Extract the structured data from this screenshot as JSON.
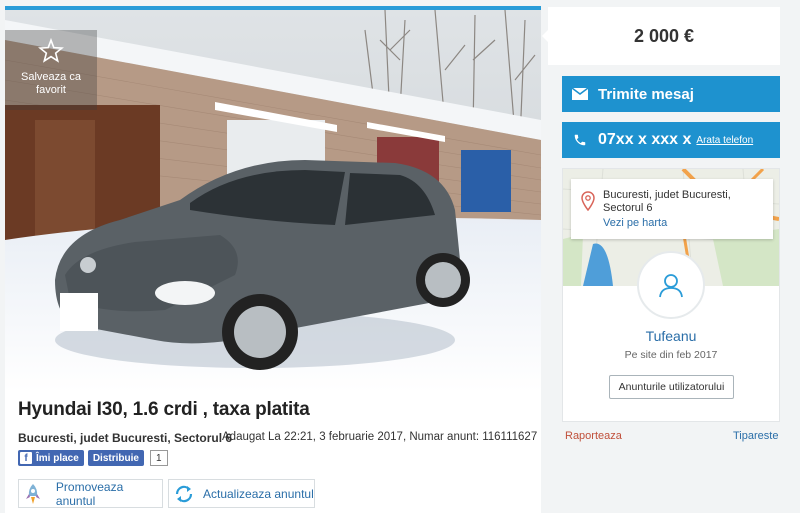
{
  "listing": {
    "favorite_label": "Salveaza ca favorit",
    "title": "Hyundai I30, 1.6 crdi , taxa platita",
    "location": "Bucuresti, judet Bucuresti, Sectorul 6",
    "meta": "Adaugat La 22:21, 3 februarie 2017, Numar anunt: 116111627",
    "fb_like": "Îmi place",
    "fb_share": "Distribuie",
    "fb_count": "1",
    "promote_label": "Promoveaza anuntul",
    "refresh_label": "Actualizeaza anuntul"
  },
  "sidebar": {
    "price": "2 000 €",
    "message_button": "Trimite mesaj",
    "phone_masked": "07xx x xxx x",
    "show_phone": "Arata telefon",
    "map_address": "Bucuresti, judet Bucuresti, Sectorul 6",
    "map_link": "Vezi pe harta",
    "user_name": "Tufeanu",
    "user_since": "Pe site din feb 2017",
    "user_ads_button": "Anunturile utilizatorului",
    "report_link": "Raporteaza",
    "print_link": "Tipareste"
  },
  "colors": {
    "accent": "#1e92cf",
    "link": "#2a6ea8",
    "report": "#c0503b"
  }
}
